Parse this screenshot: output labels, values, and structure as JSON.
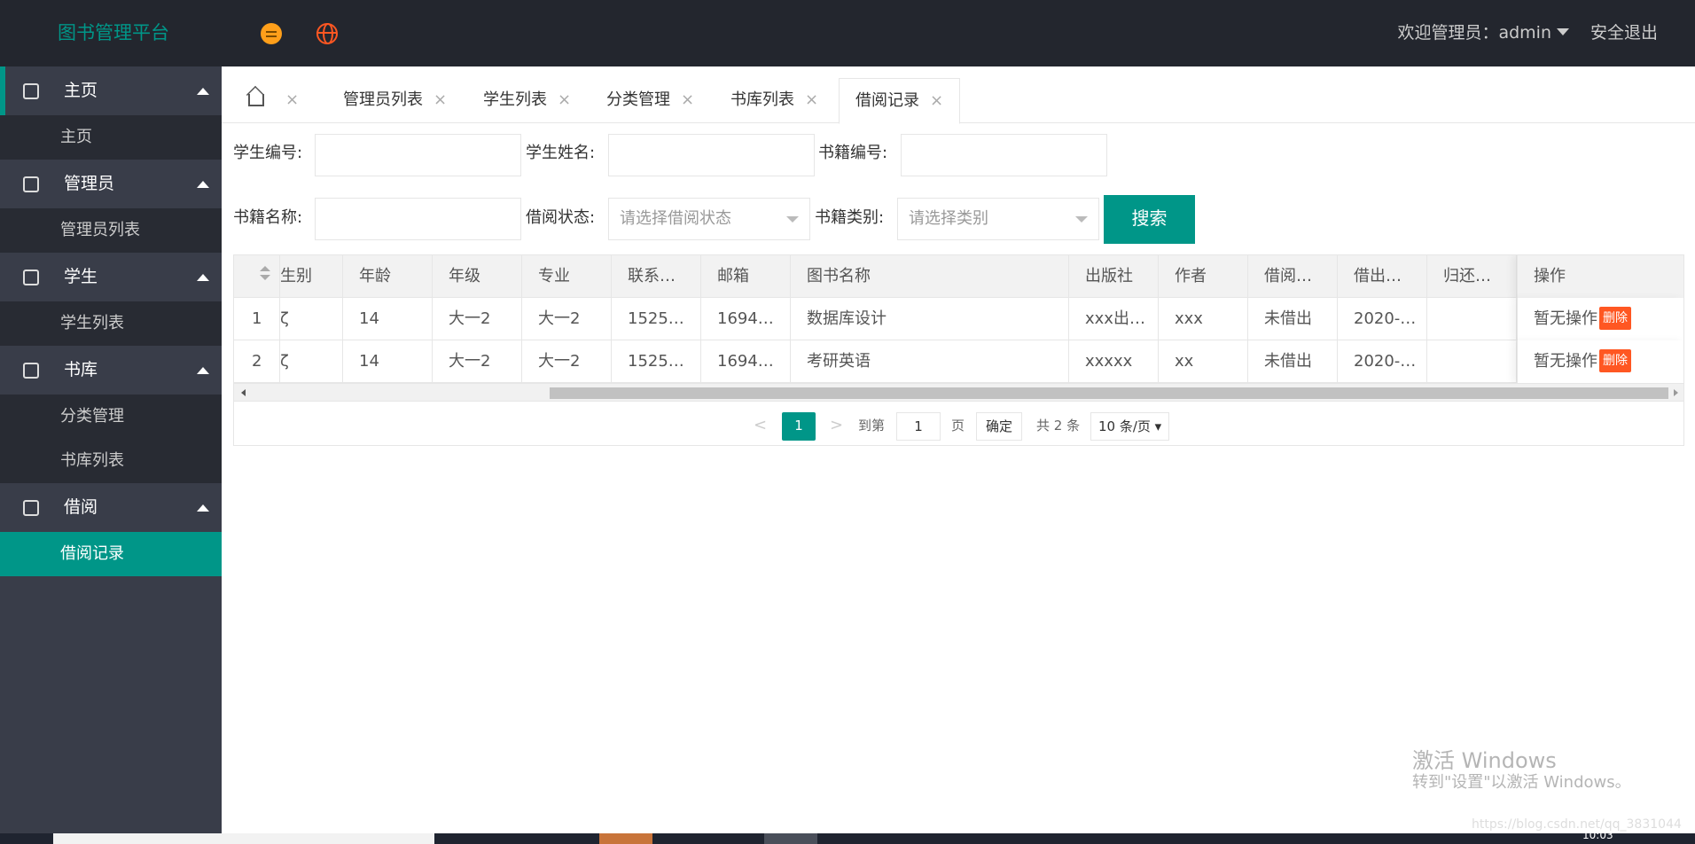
{
  "header": {
    "brand": "图书管理平台",
    "menu_toggle_icon": "menu-icon",
    "language_icon": "globe-icon",
    "user_label": "欢迎管理员：admin",
    "logout_label": "安全退出"
  },
  "sidebar": {
    "groups": [
      {
        "label": "主页",
        "icon": "home-icon",
        "items": [
          "主页"
        ]
      },
      {
        "label": "管理员",
        "icon": "shield-icon",
        "items": [
          "管理员列表"
        ]
      },
      {
        "label": "学生",
        "icon": "user-icon",
        "items": [
          "学生列表"
        ]
      },
      {
        "label": "书库",
        "icon": "box-icon",
        "items": [
          "分类管理",
          "书库列表"
        ]
      },
      {
        "label": "借阅",
        "icon": "edit-icon",
        "items": [
          "借阅记录"
        ]
      }
    ],
    "active_item": "借阅记录"
  },
  "tabs": {
    "items": [
      "管理员列表",
      "学生列表",
      "分类管理",
      "书库列表",
      "借阅记录"
    ],
    "close_glyph": "×",
    "active": "借阅记录"
  },
  "search": {
    "student_id_label": "学生编号:",
    "student_name_label": "学生姓名:",
    "book_id_label": "书籍编号:",
    "book_name_label": "书籍名称:",
    "borrow_status_label": "借阅状态:",
    "borrow_status_placeholder": "请选择借阅状态",
    "category_label": "书籍类别:",
    "category_placeholder": "请选择类别",
    "search_button": "搜索"
  },
  "table": {
    "columns": [
      "",
      "生别",
      "年龄",
      "年级",
      "专业",
      "联系…",
      "邮箱",
      "图书名称",
      "出版社",
      "作者",
      "借阅…",
      "借出…",
      "归还…",
      "操作"
    ],
    "rows": [
      {
        "index": "1",
        "gender": "ζ",
        "age": "14",
        "grade": "大一2",
        "major": "大一2",
        "contact": "1525…",
        "email": "1694…",
        "book_name": "数据库设计",
        "publisher": "xxx出…",
        "author": "xxx",
        "status": "未借出",
        "borrow_date": "2020-…",
        "return_date": "",
        "op_text": "暂无操作",
        "op_button": "删除"
      },
      {
        "index": "2",
        "gender": "ζ",
        "age": "14",
        "grade": "大一2",
        "major": "大一2",
        "contact": "1525…",
        "email": "1694…",
        "book_name": "考研英语",
        "publisher": "xxxxx",
        "author": "xx",
        "status": "未借出",
        "borrow_date": "2020-…",
        "return_date": "",
        "op_text": "暂无操作",
        "op_button": "删除"
      }
    ]
  },
  "pagination": {
    "prev": "<",
    "current_page": "1",
    "next": ">",
    "goto_label": "到第",
    "goto_value": "1",
    "page_unit": "页",
    "confirm": "确定",
    "total": "共 2 条",
    "page_size": "10 条/页 ▾"
  },
  "watermark": {
    "line1": "激活 Windows",
    "line2": "转到\"设置\"以激活 Windows。",
    "url": "https://blog.csdn.net/qq_3831044"
  },
  "taskbar": {
    "clock": "10:03"
  },
  "colors": {
    "accent": "#009688",
    "header_bg": "#23262e",
    "sidebar_bg": "#393d49",
    "danger": "#ff5722"
  }
}
